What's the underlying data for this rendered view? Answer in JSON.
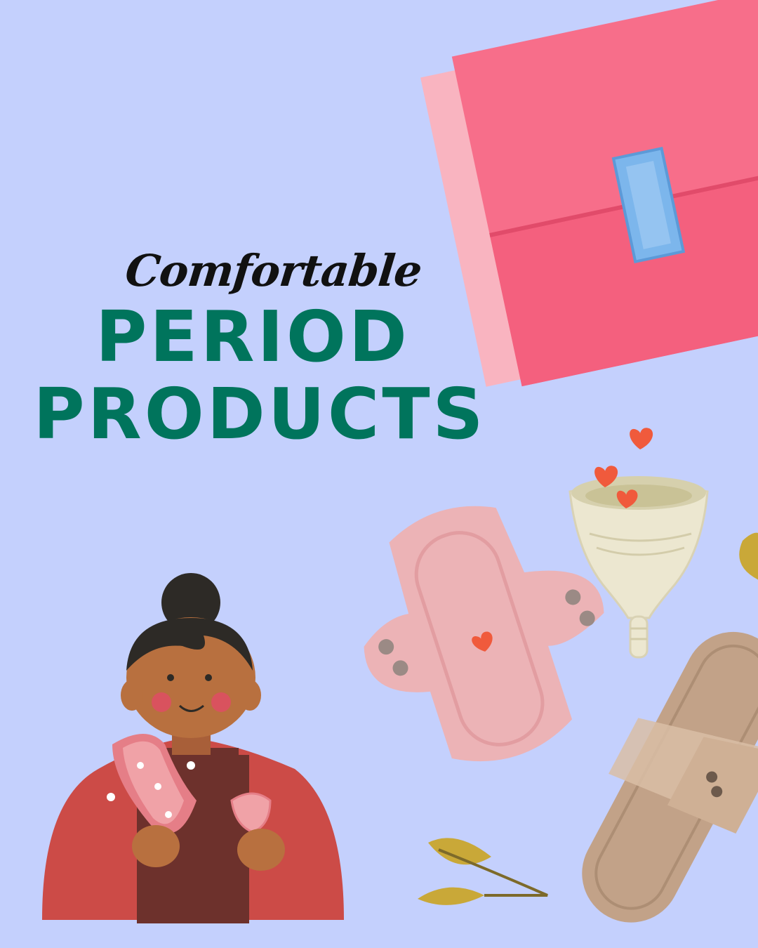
{
  "headline": {
    "script": "Comfortable",
    "line1": "PERIOD",
    "line2": "PRODUCTS"
  },
  "colors": {
    "background": "#c4d0fd",
    "title_green": "#00745c",
    "script_black": "#111111",
    "pad_pink": "#f76e8a",
    "cloth_pad": "#ecb3b6",
    "cup": "#ece7d0",
    "hearts": "#f05a3c",
    "liner": "#c2a288",
    "leaves": "#c9a838",
    "sweater": "#cc4b47"
  },
  "illustrations": [
    "packaged-sanitary-pad",
    "menstrual-cup-with-hearts",
    "reusable-cloth-pad",
    "panty-liner",
    "olive-leaves",
    "woman-holding-pad-and-cup"
  ]
}
